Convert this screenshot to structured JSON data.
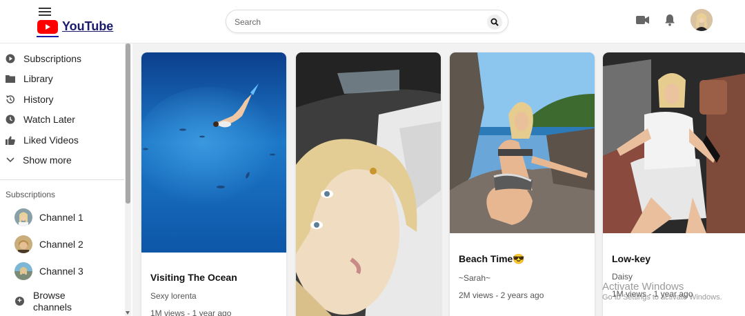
{
  "header": {
    "logo_text": "YouTube",
    "search": {
      "placeholder": "Search",
      "value": ""
    },
    "icons": [
      "menu-icon",
      "youtube-logo-icon",
      "search-icon",
      "video-camera-icon",
      "bell-icon",
      "avatar"
    ]
  },
  "sidebar": {
    "items": [
      {
        "label": "Subscriptions",
        "icon": "play-circle-icon"
      },
      {
        "label": "Library",
        "icon": "folder-icon"
      },
      {
        "label": "History",
        "icon": "history-icon"
      },
      {
        "label": "Watch Later",
        "icon": "clock-icon"
      },
      {
        "label": "Liked Videos",
        "icon": "thumbs-up-icon"
      },
      {
        "label": "Show more",
        "icon": "chevron-down-icon"
      }
    ],
    "subscriptions_heading": "Subscriptions",
    "channels": [
      {
        "label": "Channel 1"
      },
      {
        "label": "Channel 2"
      },
      {
        "label": "Channel 3"
      }
    ],
    "browse_label": "Browse channels"
  },
  "videos": [
    {
      "title": "Visiting The Ocean",
      "author": "Sexy lorenta",
      "meta": "1M views - 1 year ago"
    },
    {
      "title": "",
      "author": "",
      "meta": ""
    },
    {
      "title": "Beach Time😎",
      "author": "~Sarah~",
      "meta": "2M views - 2 years ago"
    },
    {
      "title": "Low-key",
      "author": "Daisy",
      "meta": "1M views - 1 year ago"
    }
  ],
  "watermark": {
    "line1": "Activate Windows",
    "line2": "Go to Settings to activate Windows."
  },
  "colors": {
    "brand_red": "#ff0000",
    "content_bg": "#f2f2f2",
    "text": "#0f0f0f"
  }
}
